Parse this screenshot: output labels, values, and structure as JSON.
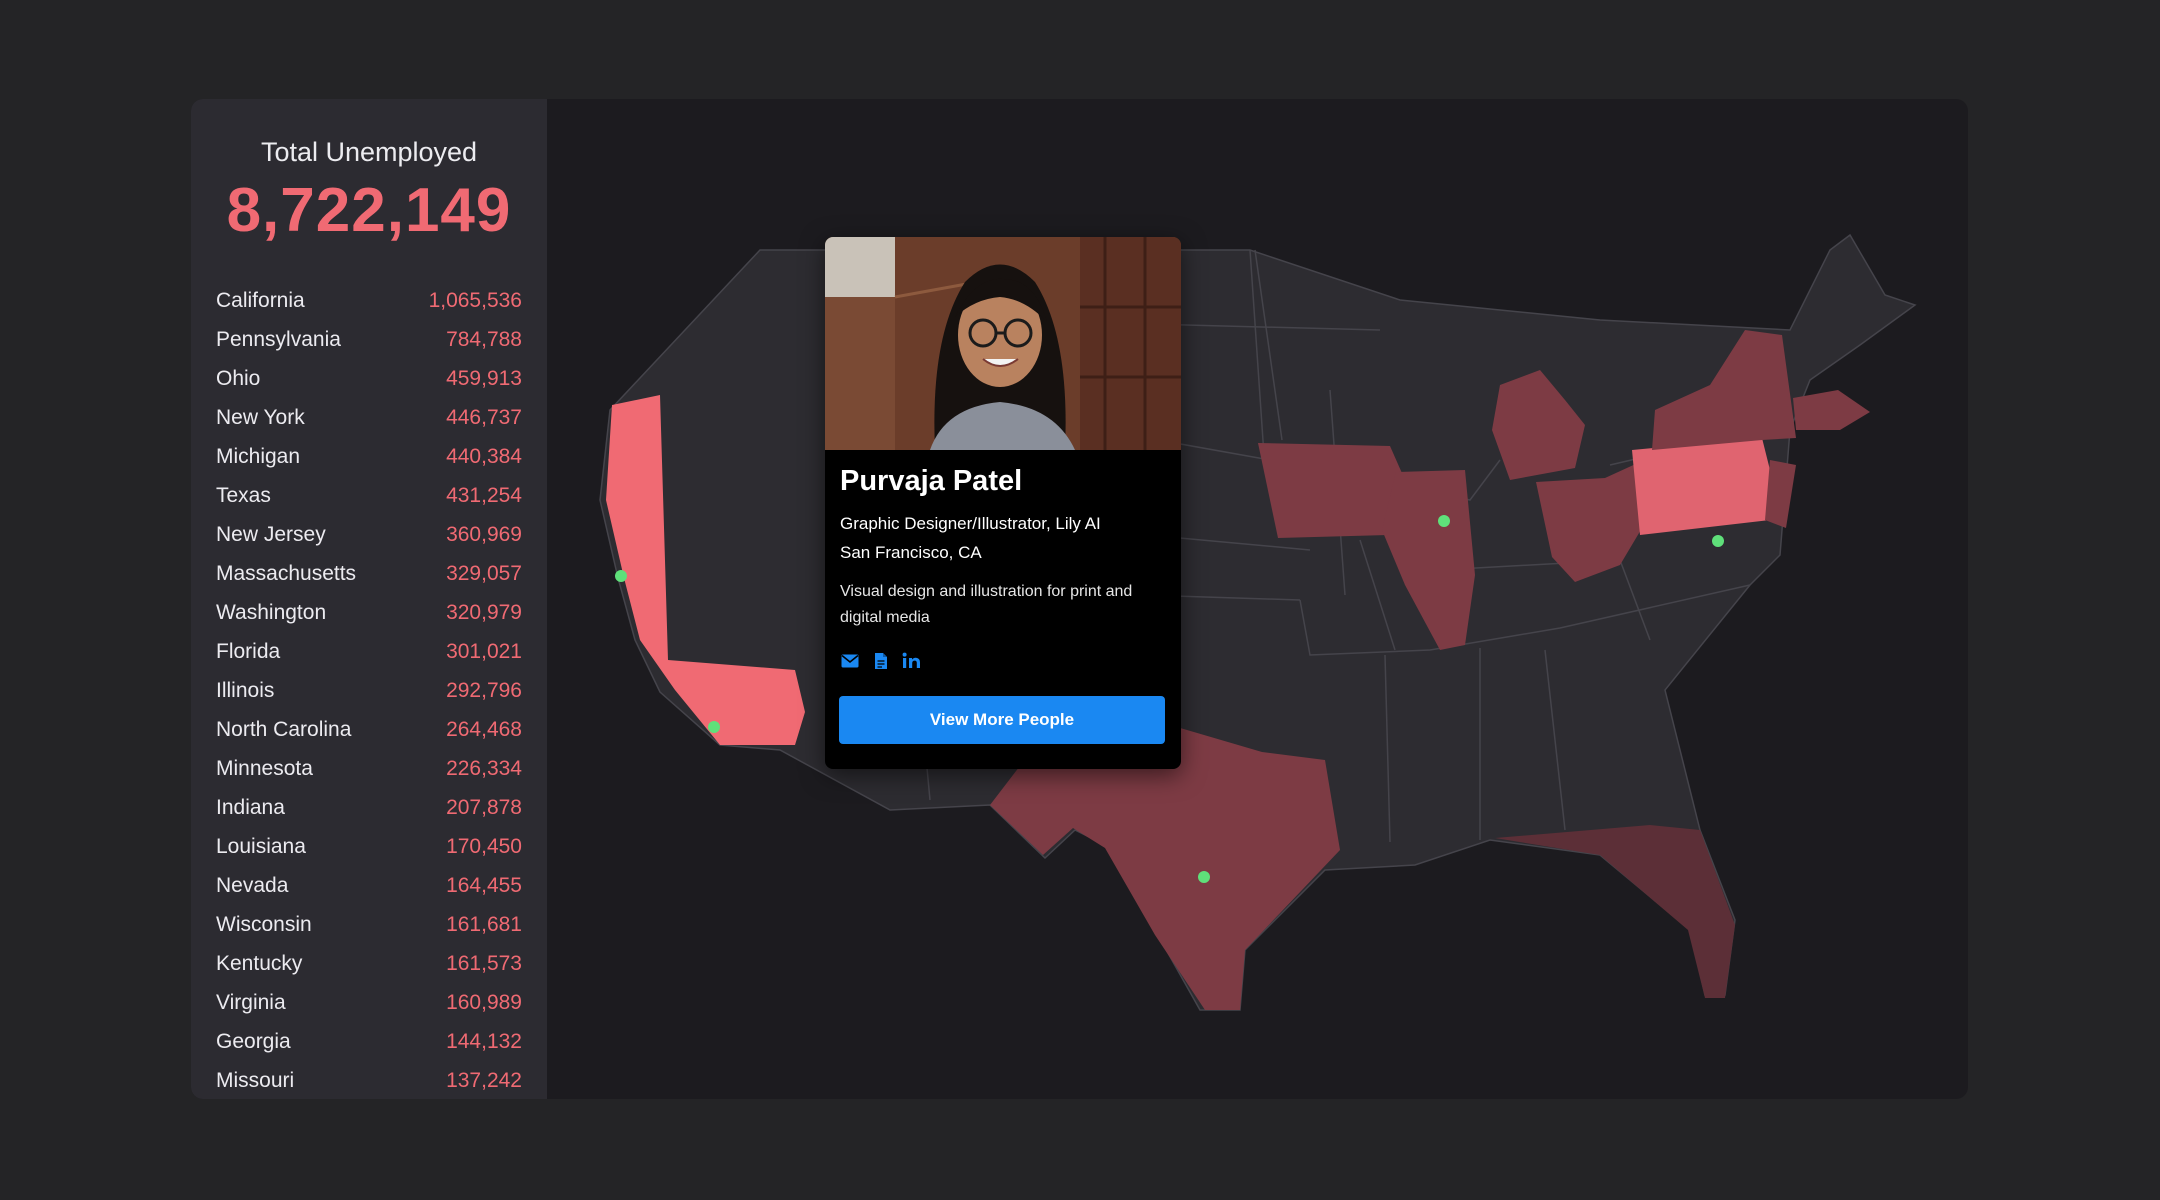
{
  "summary": {
    "label": "Total Unemployed",
    "value": "8,722,149"
  },
  "states": [
    {
      "name": "California",
      "count": "1,065,536"
    },
    {
      "name": "Pennsylvania",
      "count": "784,788"
    },
    {
      "name": "Ohio",
      "count": "459,913"
    },
    {
      "name": "New York",
      "count": "446,737"
    },
    {
      "name": "Michigan",
      "count": "440,384"
    },
    {
      "name": "Texas",
      "count": "431,254"
    },
    {
      "name": "New Jersey",
      "count": "360,969"
    },
    {
      "name": "Massachusetts",
      "count": "329,057"
    },
    {
      "name": "Washington",
      "count": "320,979"
    },
    {
      "name": "Florida",
      "count": "301,021"
    },
    {
      "name": "Illinois",
      "count": "292,796"
    },
    {
      "name": "North Carolina",
      "count": "264,468"
    },
    {
      "name": "Minnesota",
      "count": "226,334"
    },
    {
      "name": "Indiana",
      "count": "207,878"
    },
    {
      "name": "Louisiana",
      "count": "170,450"
    },
    {
      "name": "Nevada",
      "count": "164,455"
    },
    {
      "name": "Wisconsin",
      "count": "161,681"
    },
    {
      "name": "Kentucky",
      "count": "161,573"
    },
    {
      "name": "Virginia",
      "count": "160,989"
    },
    {
      "name": "Georgia",
      "count": "144,132"
    },
    {
      "name": "Missouri",
      "count": "137,242"
    }
  ],
  "profile": {
    "name": "Purvaja Patel",
    "role": "Graphic Designer/Illustrator, Lily AI",
    "location": "San Francisco, CA",
    "bio": "Visual design and illustration for print and digital media",
    "icons": [
      "email-icon",
      "document-icon",
      "linkedin-icon"
    ],
    "button_label": "View More People"
  },
  "colors": {
    "accent_red": "#f06a73",
    "state_medium": "#7d3b44",
    "state_dark": "#2a1d22",
    "state_default": "#2d2c31",
    "marker_green": "#5fe07a",
    "button_blue": "#1a88f2"
  }
}
